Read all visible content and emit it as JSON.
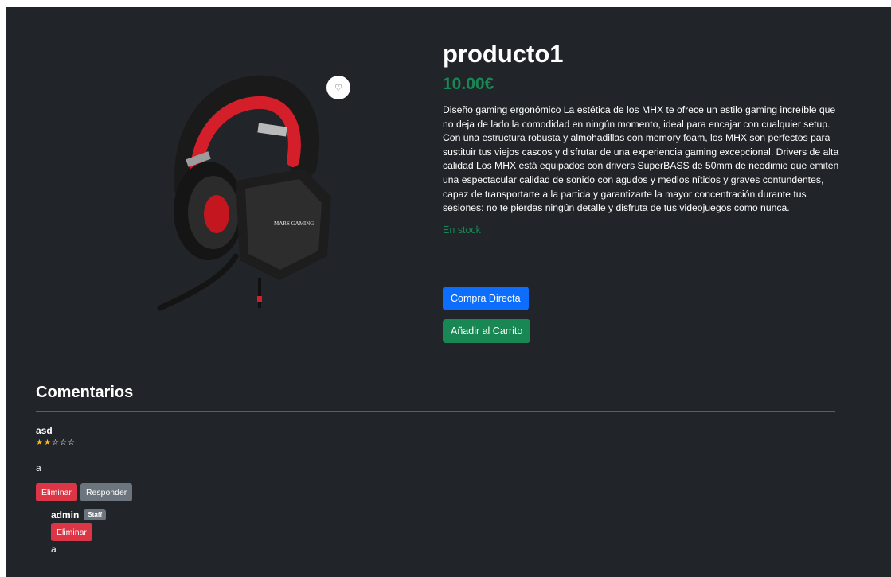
{
  "product": {
    "title": "producto1",
    "price": "10.00€",
    "description": "Diseño gaming ergonómico La estética de los MHX te ofrece un estilo gaming increíble que no deja de lado la comodidad en ningún momento, ideal para encajar con cualquier setup. Con una estructura robusta y almohadillas con memory foam, los MHX son perfectos para sustituir tus viejos cascos y disfrutar de una experiencia gaming excepcional. Drivers de alta calidad Los MHX está equipados con drivers SuperBASS de 50mm de neodimio que emiten una espectacular calidad de sonido con agudos y medios nítidos y graves contundentes, capaz de transportarte a la partida y garantizarte la mayor concentración durante tus sesiones: no te pierdas ningún detalle y disfruta de tus videojuegos como nunca.",
    "stock": "En stock",
    "buy_label": "Compra Directa",
    "cart_label": "Añadir al Carrito",
    "image_brand_text": "MARS GAMING",
    "favorite_icon": "heart-icon"
  },
  "comments": {
    "title": "Comentarios",
    "items": [
      {
        "author": "asd",
        "rating": 2,
        "max_rating": 5,
        "text": "a",
        "delete_label": "Eliminar",
        "reply_label": "Responder",
        "replies": [
          {
            "author": "admin",
            "badge": "Staff",
            "delete_label": "Eliminar",
            "text": "a"
          }
        ]
      }
    ]
  },
  "colors": {
    "background": "#212529",
    "success": "#198754",
    "primary": "#0d6efd",
    "danger": "#dc3545",
    "secondary": "#6c757d",
    "star": "#ffc107"
  }
}
